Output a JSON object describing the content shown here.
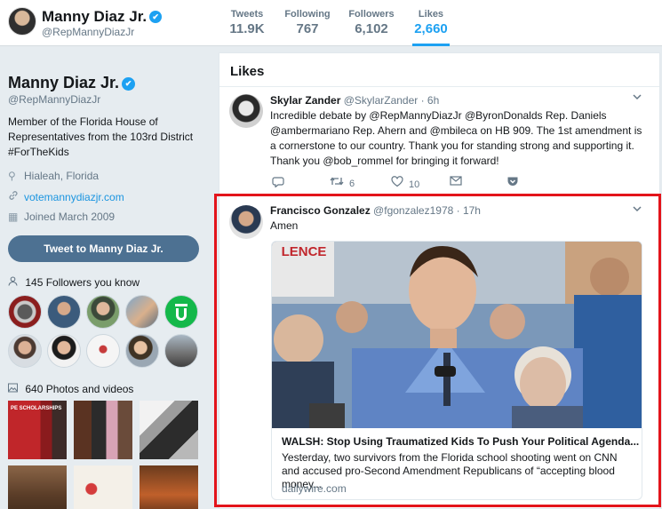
{
  "header": {
    "name": "Manny Diaz Jr.",
    "handle": "@RepMannyDiazJr",
    "stats": [
      {
        "label": "Tweets",
        "value": "11.9K"
      },
      {
        "label": "Following",
        "value": "767"
      },
      {
        "label": "Followers",
        "value": "6,102"
      },
      {
        "label": "Likes",
        "value": "2,660"
      }
    ]
  },
  "profile": {
    "name": "Manny Diaz Jr.",
    "handle": "@RepMannyDiazJr",
    "bio": "Member of the Florida House of Representatives from the 103rd District #ForTheKids",
    "location": "Hialeah, Florida",
    "website": "votemannydiazjr.com",
    "joined": "Joined March 2009",
    "tweet_to_label": "Tweet to Manny Diaz Jr.",
    "followers_you_know": "145 Followers you know",
    "photos_videos": "640 Photos and videos",
    "thumb1_caption": "PE SCHOLARSHIPS"
  },
  "feed": {
    "title": "Likes",
    "tweets": [
      {
        "name": "Skylar Zander",
        "handle": "@SkylarZander · 6h",
        "text": "Incredible debate by @RepMannyDiazJr @ByronDonalds Rep. Daniels @ambermariano Rep. Ahern and @mbileca on HB 909. The 1st amendment is a cornerstone to our country. Thank you for standing strong and supporting it. Thank you @bob_rommel for bringing it forward!",
        "retweets": "6",
        "likes": "10"
      },
      {
        "name": "Francisco Gonzalez",
        "handle": "@fgonzalez1978 · 17h",
        "text": "Amen",
        "card": {
          "sign_text": "LENCE",
          "title": "WALSH: Stop Using Traumatized Kids To Push Your Political Agenda...",
          "description": "Yesterday, two survivors from the Florida school shooting went on CNN and accused pro-Second Amendment Republicans of “accepting blood money...",
          "domain": "dailywire.com"
        }
      }
    ]
  },
  "icons": {
    "verified": "✔",
    "caret": "⌄",
    "location": "⚲",
    "link": "🔗",
    "calendar": "▦",
    "person": "👤",
    "photo": "▣"
  },
  "colors": {
    "accent": "#1da1f2",
    "link": "#1b95e0",
    "button": "#4d7192",
    "highlight": "#e3141b"
  }
}
